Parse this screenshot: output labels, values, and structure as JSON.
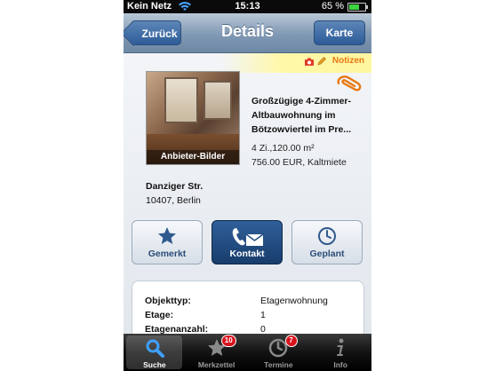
{
  "status_bar": {
    "carrier": "Kein Netz",
    "time": "15:13",
    "battery": "65 %",
    "battery_level": 0.65
  },
  "nav": {
    "back_label": "Zurück",
    "title": "Details",
    "map_label": "Karte"
  },
  "notes": {
    "label": "Notizen"
  },
  "photo": {
    "caption": "Anbieter-Bilder"
  },
  "listing": {
    "title_line1": "Großzügige 4-Zimmer-",
    "title_line2": "Altbauwohnung im",
    "title_line3": "Bötzowviertel im Pre...",
    "rooms_area": "4 Zi.,120.00 m²",
    "price": "756.00 EUR, Kaltmiete"
  },
  "address": {
    "street": "Danziger Str.",
    "city": "10407, Berlin"
  },
  "actions": {
    "bookmark": "Gemerkt",
    "contact": "Kontakt",
    "planned": "Geplant"
  },
  "details": [
    {
      "key": "Objekttyp:",
      "value": "Etagenwohnung"
    },
    {
      "key": "Etage:",
      "value": "1"
    },
    {
      "key": "Etagenanzahl:",
      "value": "0"
    }
  ],
  "tabs": [
    {
      "label": "Suche",
      "badge": ""
    },
    {
      "label": "Merkzettel",
      "badge": "10"
    },
    {
      "label": "Termine",
      "badge": "7"
    },
    {
      "label": "Info",
      "badge": ""
    }
  ],
  "colors": {
    "nav_blue": "#7f98b3",
    "button_blue": "#2c5b98",
    "notes_orange": "#e87810",
    "badge_red": "#d8121c"
  }
}
